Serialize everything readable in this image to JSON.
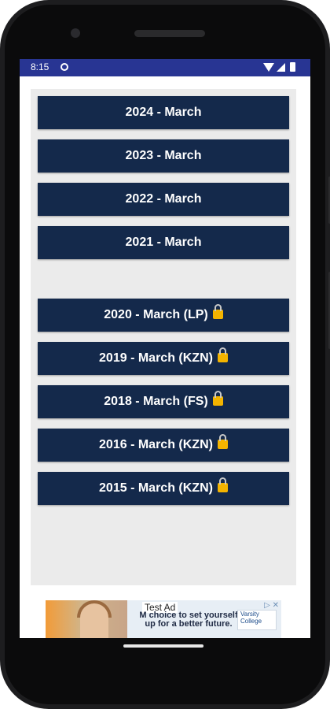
{
  "status_bar": {
    "time": "8:15"
  },
  "buttons": [
    {
      "label": "2024 - March",
      "locked": false
    },
    {
      "label": "2023 - March",
      "locked": false
    },
    {
      "label": "2022 - March",
      "locked": false
    },
    {
      "label": "2021 - March",
      "locked": false
    },
    {
      "label": "2020 - March (LP)",
      "locked": true
    },
    {
      "label": "2019 - March (KZN)",
      "locked": true
    },
    {
      "label": "2018 - March (FS)",
      "locked": true
    },
    {
      "label": "2016 - March (KZN)",
      "locked": true
    },
    {
      "label": "2015 - March (KZN)",
      "locked": true
    }
  ],
  "ad": {
    "label": "Test Ad",
    "text": "M    choice to set yourself up for a better future.",
    "brand": "Varsity College",
    "close": "▷ ✕"
  },
  "colors": {
    "status_bar": "#283593",
    "button_bg": "#14294b",
    "content_bg": "#ebebeb",
    "lock": "#f4b400"
  },
  "icons": {
    "lock": "lock-icon",
    "wifi": "wifi-icon",
    "signal": "signal-icon",
    "battery": "battery-icon"
  }
}
